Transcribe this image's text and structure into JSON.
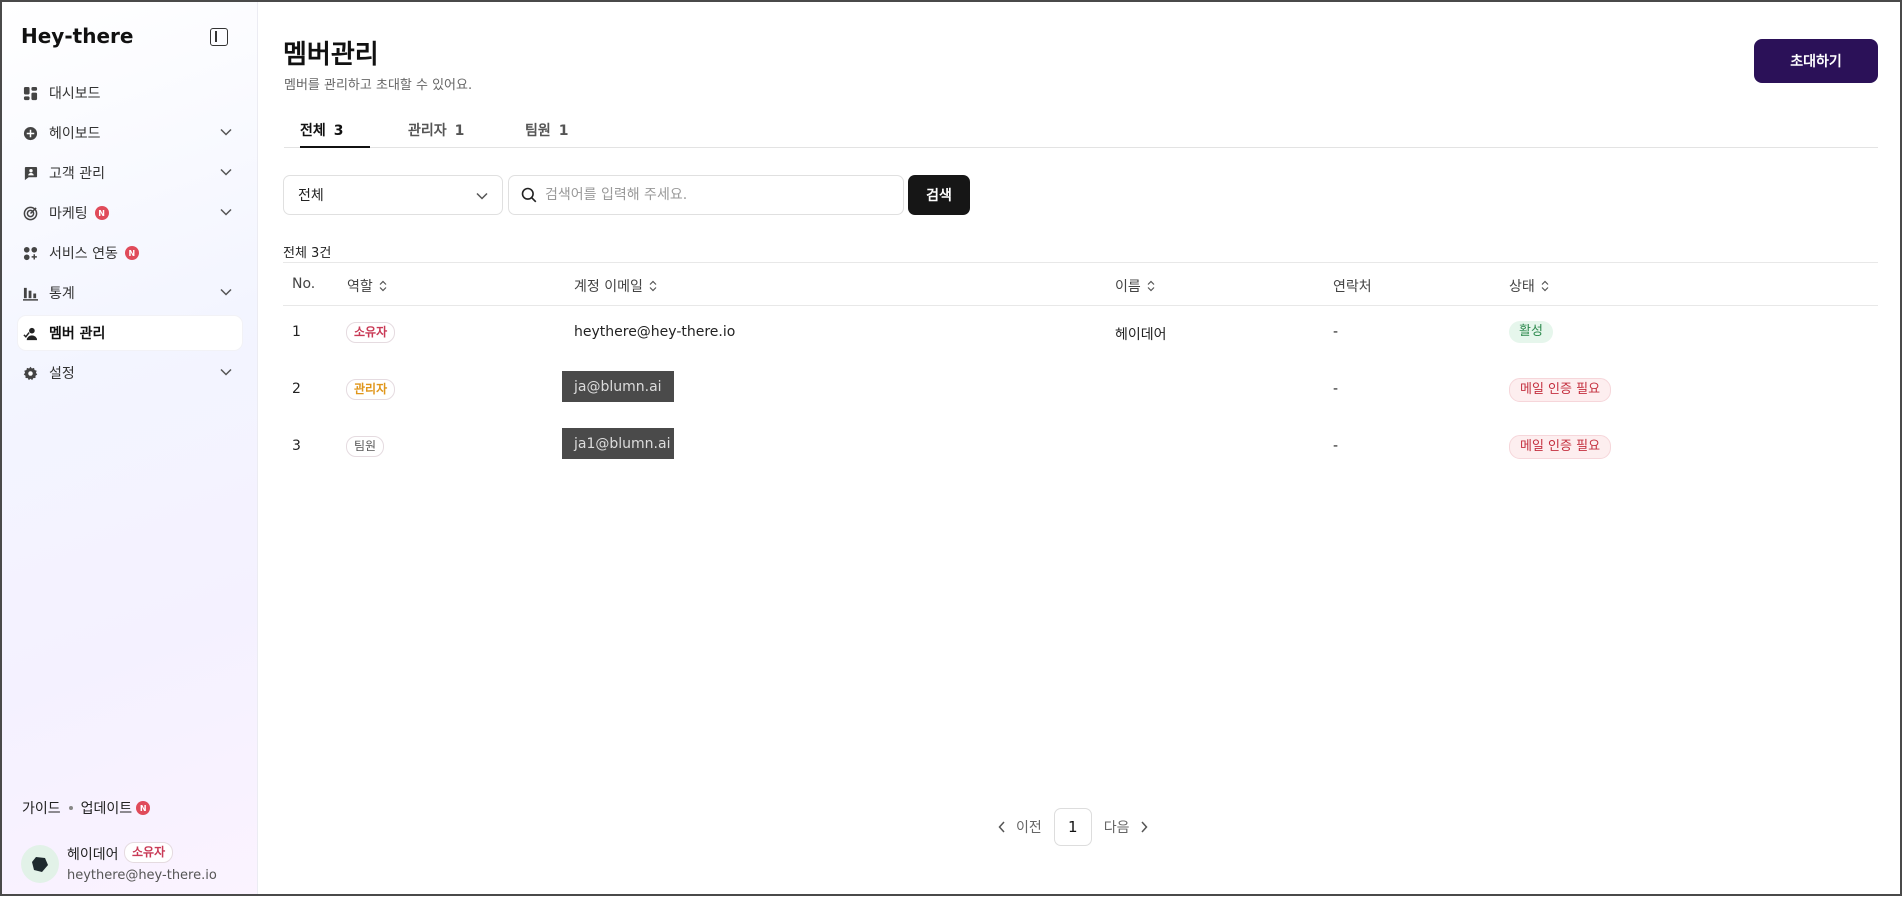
{
  "app": {
    "brand": "Hey-there"
  },
  "sidebar": {
    "items": [
      {
        "label": "대시보드",
        "icon": "dashboard-icon",
        "has_chevron": false,
        "badge": ""
      },
      {
        "label": "헤이보드",
        "icon": "plus-circle-icon",
        "has_chevron": true,
        "badge": ""
      },
      {
        "label": "고객 관리",
        "icon": "chat-user-icon",
        "has_chevron": true,
        "badge": ""
      },
      {
        "label": "마케팅",
        "icon": "target-icon",
        "has_chevron": true,
        "badge": "N"
      },
      {
        "label": "서비스 연동",
        "icon": "apps-icon",
        "has_chevron": false,
        "badge": "N"
      },
      {
        "label": "통계",
        "icon": "bar-chart-icon",
        "has_chevron": true,
        "badge": ""
      },
      {
        "label": "멤버 관리",
        "icon": "members-icon",
        "has_chevron": false,
        "badge": "",
        "active": true
      },
      {
        "label": "설정",
        "icon": "gear-icon",
        "has_chevron": true,
        "badge": ""
      }
    ],
    "guide_label": "가이드",
    "update_label": "업데이트",
    "update_badge": "N",
    "user": {
      "name": "헤이데어",
      "role": "소유자",
      "email": "heythere@hey-there.io"
    }
  },
  "header": {
    "title": "멤버관리",
    "subtitle": "멤버를 관리하고 초대할 수 있어요.",
    "invite_label": "초대하기"
  },
  "tabs": [
    {
      "label": "전체",
      "count": "3",
      "active": true
    },
    {
      "label": "관리자",
      "count": "1",
      "active": false
    },
    {
      "label": "팀원",
      "count": "1",
      "active": false
    }
  ],
  "filter": {
    "select_value": "전체",
    "search_placeholder": "검색어를 입력해 주세요.",
    "search_button": "검색"
  },
  "table": {
    "total_label": "전체 3건",
    "columns": [
      "No.",
      "역할",
      "계정 이메일",
      "이름",
      "연락처",
      "상태"
    ],
    "rows": [
      {
        "no": "1",
        "role": "소유자",
        "email": "heythere@hey-there.io",
        "name": "헤이데어",
        "contact": "-",
        "status": "활성",
        "redacted": false
      },
      {
        "no": "2",
        "role": "관리자",
        "email": "ja@blumn.ai",
        "name": "",
        "contact": "-",
        "status": "메일 인증 필요",
        "redacted": true
      },
      {
        "no": "3",
        "role": "팀원",
        "email": "ja1@blumn.ai",
        "name": "",
        "contact": "-",
        "status": "메일 인증 필요",
        "redacted": true
      }
    ]
  },
  "pagination": {
    "prev_label": "이전",
    "current": "1",
    "next_label": "다음"
  },
  "colors": {
    "primary": "#2b1158",
    "owner": "#c93a56",
    "admin": "#e0961a",
    "active_status": "#2d8a4e",
    "pending_status": "#c4303f",
    "badge": "#e04b5a"
  }
}
